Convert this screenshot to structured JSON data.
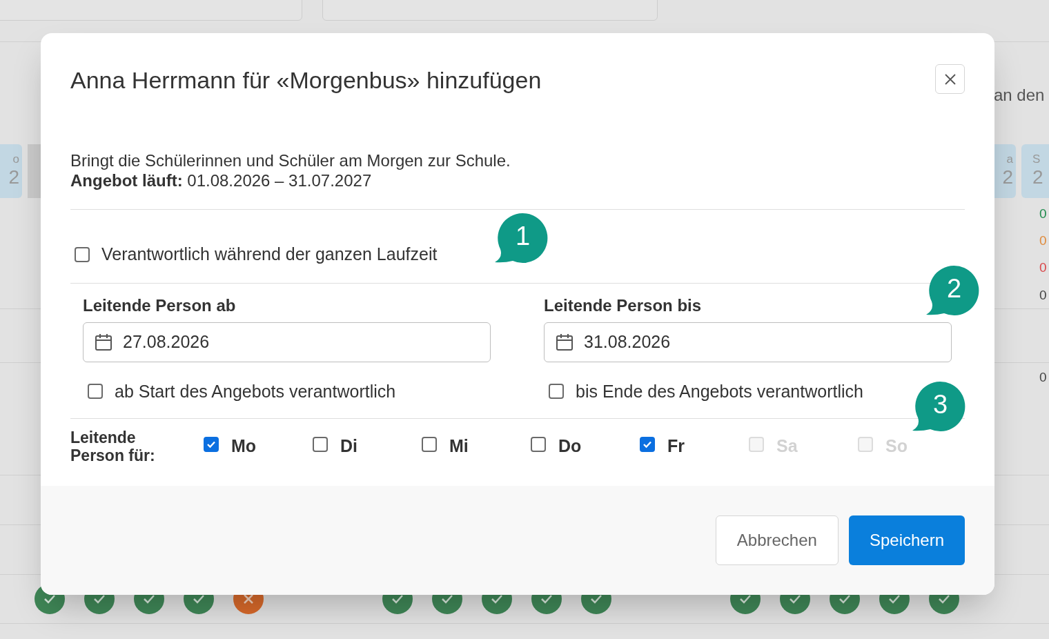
{
  "background": {
    "filters": [
      {
        "kind": "select"
      },
      {
        "kind": "select"
      }
    ],
    "note": "an den",
    "day_headers": [
      {
        "name": "o",
        "date": "2"
      },
      {
        "name": "a",
        "date": "2"
      },
      {
        "name": "S",
        "date": "2"
      }
    ],
    "count_rows": [
      {
        "color": "#1e8a4c",
        "values": [
          "0"
        ]
      },
      {
        "color": "#e08a3a",
        "values": [
          "0"
        ]
      },
      {
        "color": "#d9474a",
        "values": [
          "0"
        ]
      },
      {
        "color": "#444444",
        "values": [
          "0"
        ]
      }
    ],
    "total_row": [
      "0"
    ],
    "status_groups": [
      [
        {
          "ok": true
        },
        {
          "ok": true
        },
        {
          "ok": true
        },
        {
          "ok": true
        },
        {
          "ok": false
        }
      ],
      [
        {
          "ok": true
        },
        {
          "ok": true
        },
        {
          "ok": true
        },
        {
          "ok": true
        },
        {
          "ok": true
        }
      ],
      [
        {
          "ok": true
        },
        {
          "ok": true
        },
        {
          "ok": true
        },
        {
          "ok": true
        },
        {
          "ok": true
        }
      ]
    ]
  },
  "dialog": {
    "title": "Anna Herrmann für «Morgenbus» hinzufügen",
    "description": "Bringt die Schülerinnen und Schüler am Morgen zur Schule.",
    "period": "**Angebot läuft:** 01.08.2026 – 31.07.2027",
    "whole_period": {
      "label": "Verantwortlich während der ganzen Laufzeit",
      "checked": false
    },
    "from": {
      "label": "Leitende Person ab",
      "value": "27.08.2026",
      "option": {
        "label": "ab Start des Angebots verantwortlich",
        "checked": false
      }
    },
    "to": {
      "label": "Leitende Person bis",
      "value": "31.08.2026",
      "option": {
        "label": "bis Ende des Angebots verantwortlich",
        "checked": false
      }
    },
    "days_label": "Leitende Person für:",
    "days": [
      {
        "label": "Mo",
        "checked": true,
        "disabled": false
      },
      {
        "label": "Di",
        "checked": false,
        "disabled": false
      },
      {
        "label": "Mi",
        "checked": false,
        "disabled": false
      },
      {
        "label": "Do",
        "checked": false,
        "disabled": false
      },
      {
        "label": "Fr",
        "checked": true,
        "disabled": false
      },
      {
        "label": "Sa",
        "checked": false,
        "disabled": true
      },
      {
        "label": "So",
        "checked": false,
        "disabled": true
      }
    ],
    "markers": [
      "1",
      "2",
      "3"
    ],
    "buttons": [
      {
        "label": "Abbrechen",
        "kind": "secondary"
      },
      {
        "label": "Speichern",
        "kind": "primary"
      }
    ]
  }
}
